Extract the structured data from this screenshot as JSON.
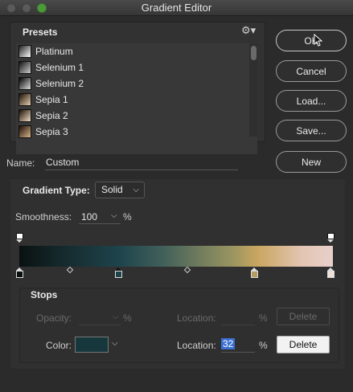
{
  "window": {
    "title": "Gradient Editor"
  },
  "presets": {
    "label": "Presets",
    "items": [
      {
        "label": "Platinum",
        "swatch": "linear-gradient(135deg,#222 0%,#fff 100%)"
      },
      {
        "label": "Selenium 1",
        "swatch": "linear-gradient(135deg,#111 0%,#ccc 100%)"
      },
      {
        "label": "Selenium 2",
        "swatch": "linear-gradient(135deg,#000 0%,#ddd 100%)"
      },
      {
        "label": "Sepia 1",
        "swatch": "linear-gradient(135deg,#1a0e05 0%,#e8cfae 100%)"
      },
      {
        "label": "Sepia 2",
        "swatch": "linear-gradient(135deg,#1a0e05 0%,#f0dcc0 100%)"
      },
      {
        "label": "Sepia 3",
        "swatch": "linear-gradient(135deg,#1a0e05 0%,#d9b48a 100%)"
      }
    ]
  },
  "buttons": {
    "ok": "OK",
    "cancel": "Cancel",
    "load": "Load...",
    "save": "Save...",
    "new": "New"
  },
  "name": {
    "label": "Name:",
    "value": "Custom"
  },
  "gradient_type": {
    "label": "Gradient Type:",
    "value": "Solid"
  },
  "smoothness": {
    "label": "Smoothness:",
    "value": "100",
    "unit": "%"
  },
  "stops": {
    "label": "Stops",
    "opacity": {
      "label": "Opacity:",
      "unit": "%"
    },
    "opacity_location": {
      "label": "Location:",
      "unit": "%",
      "delete": "Delete"
    },
    "color": {
      "label": "Color:",
      "value": "#16383c"
    },
    "color_location": {
      "label": "Location:",
      "value": "32",
      "unit": "%",
      "delete": "Delete"
    }
  }
}
